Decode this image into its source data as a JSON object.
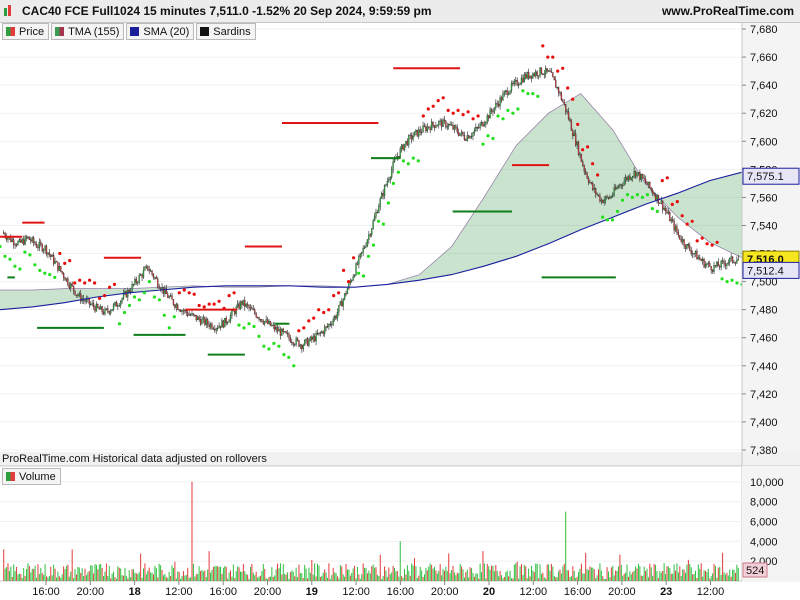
{
  "header": {
    "title": "CAC40 FCE Full1024 15 minutes 7,511.0 -1.52% 20 Sep 2024, 9:59:59 pm",
    "site": "www.ProRealTime.com"
  },
  "legend": [
    {
      "label": "Price",
      "color": "#2e9e3e"
    },
    {
      "label": "TMA (155)",
      "color": "#8a4fa0"
    },
    {
      "label": "SMA (20)",
      "color": "#1a1f9c"
    },
    {
      "label": "Sardins",
      "color": "#111111"
    }
  ],
  "attribution": "ProRealTime.com  Historical data adjusted on rollovers",
  "volume_label": "Volume",
  "price_tags": {
    "upper": "7,575.1",
    "current": "7,516.0",
    "lower": "7,512.4"
  },
  "volume_tag": "524",
  "colors": {
    "up": "#2fbf3f",
    "down": "#e33b3b",
    "sma": "#1a1f9c",
    "sar_up": "#22e01c",
    "sar_down": "#e80c0c",
    "fill_green": "#3c9a52",
    "fill_red": "#a2364e"
  },
  "chart_data": [
    {
      "type": "candlestick",
      "title": "CAC40 FCE Full1024 15 minutes",
      "y_ticks": [
        "7,680",
        "7,660",
        "7,640",
        "7,620",
        "7,600",
        "7,580",
        "7,560",
        "7,540",
        "7,520",
        "7,500",
        "7,480",
        "7,460",
        "7,440",
        "7,420",
        "7,400",
        "7,380"
      ],
      "ylim": [
        7380,
        7685
      ],
      "x_ticks": [
        "16:00",
        "20:00",
        "18",
        "12:00",
        "16:00",
        "20:00",
        "19",
        "12:00",
        "16:00",
        "20:00",
        "20",
        "12:00",
        "16:00",
        "20:00",
        "23",
        "12:00"
      ],
      "close_path": [
        7535,
        7530,
        7527,
        7531,
        7526,
        7524,
        7515,
        7506,
        7497,
        7489,
        7485,
        7481,
        7478,
        7482,
        7488,
        7495,
        7503,
        7510,
        7501,
        7492,
        7485,
        7480,
        7476,
        7473,
        7470,
        7468,
        7471,
        7478,
        7485,
        7480,
        7475,
        7470,
        7466,
        7462,
        7458,
        7455,
        7458,
        7462,
        7468,
        7476,
        7490,
        7505,
        7520,
        7536,
        7555,
        7572,
        7588,
        7598,
        7604,
        7608,
        7611,
        7613,
        7612,
        7608,
        7603,
        7606,
        7612,
        7620,
        7628,
        7636,
        7641,
        7646,
        7648,
        7650,
        7648,
        7636,
        7620,
        7600,
        7580,
        7566,
        7558,
        7560,
        7568,
        7574,
        7578,
        7572,
        7564,
        7556,
        7545,
        7533,
        7525,
        7519,
        7513,
        7510,
        7512,
        7515,
        7516
      ],
      "series": [
        {
          "name": "SMA (20)",
          "values": [
            7480,
            7482,
            7485,
            7489,
            7492,
            7494,
            7496,
            7497,
            7497,
            7497,
            7496,
            7496,
            7498,
            7501,
            7505,
            7511,
            7518,
            7527,
            7537,
            7546,
            7555,
            7563,
            7572,
            7578
          ]
        },
        {
          "name": "TMA (155)",
          "values": [
            7494,
            7494,
            7495,
            7495,
            7495,
            7496,
            7497,
            7496,
            7496,
            7497,
            7497,
            7496,
            7498,
            7505,
            7525,
            7560,
            7597,
            7620,
            7634,
            7608,
            7570,
            7546,
            7528,
            7517
          ]
        }
      ],
      "sardins_levels": [
        {
          "x_span": [
            0.01,
            0.02
          ],
          "y": 7503
        },
        {
          "x_span": [
            0.05,
            0.14
          ],
          "y": 7467
        },
        {
          "x_span": [
            0.18,
            0.25
          ],
          "y": 7462
        },
        {
          "x_span": [
            0.28,
            0.33
          ],
          "y": 7448
        },
        {
          "x_span": [
            0.37,
            0.39
          ],
          "y": 7470
        },
        {
          "x_span": [
            0.5,
            0.54
          ],
          "y": 7588
        },
        {
          "x_span": [
            0.61,
            0.69
          ],
          "y": 7550
        },
        {
          "x_span": [
            0.73,
            0.83
          ],
          "y": 7503
        }
      ],
      "resistance_levels": [
        {
          "x_span": [
            0.0,
            0.03
          ],
          "y": 7532
        },
        {
          "x_span": [
            0.03,
            0.06
          ],
          "y": 7542
        },
        {
          "x_span": [
            0.14,
            0.19
          ],
          "y": 7517
        },
        {
          "x_span": [
            0.25,
            0.32
          ],
          "y": 7480
        },
        {
          "x_span": [
            0.33,
            0.38
          ],
          "y": 7525
        },
        {
          "x_span": [
            0.38,
            0.51
          ],
          "y": 7613
        },
        {
          "x_span": [
            0.53,
            0.62
          ],
          "y": 7652
        },
        {
          "x_span": [
            0.69,
            0.74
          ],
          "y": 7583
        }
      ]
    },
    {
      "type": "bar",
      "title": "Volume",
      "y_ticks": [
        "10,000",
        "8,000",
        "6,000",
        "4,000",
        "2,000"
      ],
      "ylim": [
        0,
        11200
      ],
      "spikes": [
        {
          "x_frac": 0.258,
          "value": 10000
        },
        {
          "x_frac": 0.762,
          "value": 7000
        },
        {
          "x_frac": 0.54,
          "value": 4000
        }
      ]
    }
  ]
}
